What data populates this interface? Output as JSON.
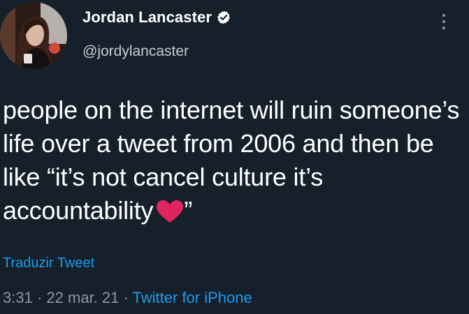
{
  "author": {
    "display_name": "Jordan Lancaster",
    "handle": "@jordylancaster",
    "verified": true
  },
  "tweet": {
    "text": "people on the internet will ruin someone’s life over a tweet from 2006 and then be like “it’s not cancel culture it’s accountability",
    "text_after_emoji": "”",
    "emoji": "heart-icon",
    "translate_label": "Traduzir Tweet"
  },
  "meta": {
    "time": "3:31",
    "sep1": "·",
    "date": "22 mar. 21",
    "sep2": "·",
    "source": "Twitter for iPhone"
  },
  "colors": {
    "background": "#15202b",
    "link": "#1d9bf0",
    "secondary_text": "#8b98a5",
    "heart": "#e0245e"
  }
}
